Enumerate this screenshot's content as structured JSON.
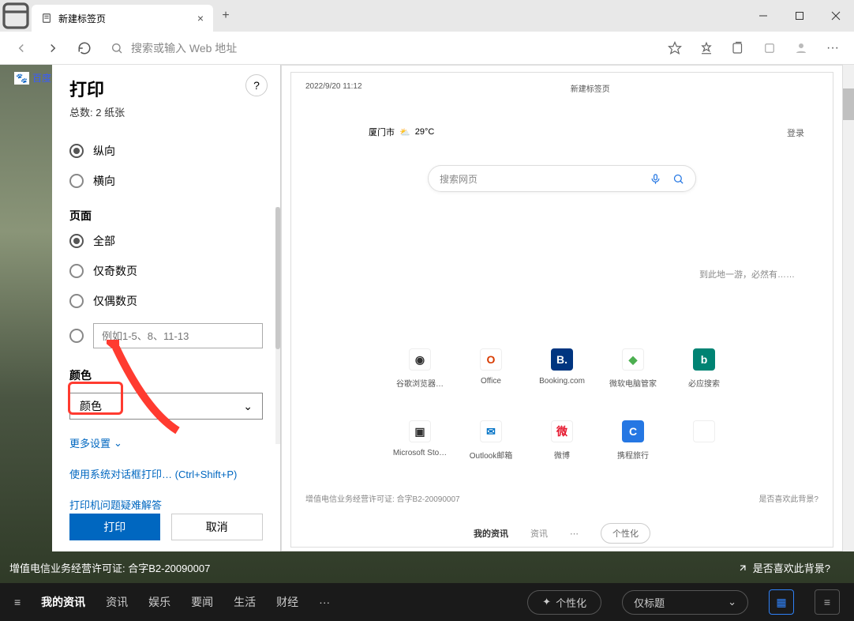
{
  "tab": {
    "title": "新建标签页"
  },
  "address": {
    "placeholder": "搜索或输入 Web 地址"
  },
  "bg_page_label": "百度",
  "print": {
    "title": "打印",
    "total": "总数: 2 纸张",
    "orientation": {
      "portrait": "纵向",
      "landscape": "横向"
    },
    "pages": {
      "head": "页面",
      "all": "全部",
      "odd": "仅奇数页",
      "even": "仅偶数页",
      "custom_placeholder": "例如1-5、8、11-13"
    },
    "color": {
      "head": "颜色",
      "select": "颜色"
    },
    "links": {
      "more": "更多设置",
      "system": "使用系统对话框打印… (Ctrl+Shift+P)",
      "faq": "打印机问题疑难解答"
    },
    "buttons": {
      "print": "打印",
      "cancel": "取消"
    }
  },
  "preview": {
    "time": "2022/9/20 11:12",
    "title": "新建标签页",
    "city": "厦门市",
    "temp": "29°C",
    "login": "登录",
    "search_placeholder": "搜索网页",
    "quote": "到此地一游，必然有……",
    "tiles": [
      {
        "label": "谷歌浏览器…",
        "bg": "#fff",
        "fg": "#333",
        "initial": "◉"
      },
      {
        "label": "Office",
        "bg": "#fff",
        "fg": "#d83b01",
        "initial": "O"
      },
      {
        "label": "Booking.com",
        "bg": "#003580",
        "fg": "#fff",
        "initial": "B."
      },
      {
        "label": "微软电脑管家",
        "bg": "#fff",
        "fg": "#4caf50",
        "initial": "◆"
      },
      {
        "label": "必应搜索",
        "bg": "#008373",
        "fg": "#fff",
        "initial": "b"
      },
      {
        "label": "Microsoft Sto…",
        "bg": "#fff",
        "fg": "#333",
        "initial": "▣"
      },
      {
        "label": "Outlook邮箱",
        "bg": "#fff",
        "fg": "#0072c6",
        "initial": "✉"
      },
      {
        "label": "微博",
        "bg": "#fff",
        "fg": "#e6162d",
        "initial": "微"
      },
      {
        "label": "携程旅行",
        "bg": "#2577e3",
        "fg": "#fff",
        "initial": "C"
      }
    ],
    "empty_tile": " ",
    "license": "增值电信业务经营许可证: 合字B2-20090007",
    "bg_q": "是否喜欢此背景?",
    "nav": {
      "mine": "我的资讯",
      "news": "资讯",
      "dots": "⋯",
      "personalize": "个性化"
    }
  },
  "footer": {
    "license": "增值电信业务经营许可证: 合字B2-20090007",
    "bg_q": "是否喜欢此背景?",
    "nav": [
      "我的资讯",
      "资讯",
      "娱乐",
      "要闻",
      "生活",
      "财经"
    ],
    "dots": "···",
    "personalize": "个性化",
    "view_select": "仅标题"
  }
}
